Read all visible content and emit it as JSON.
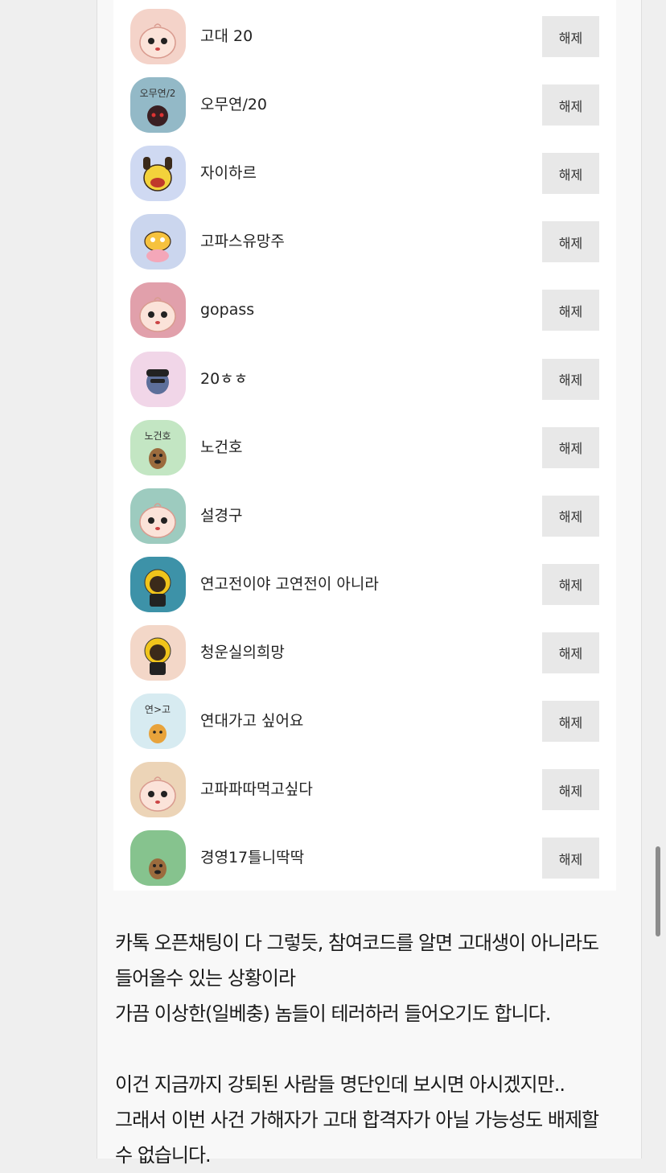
{
  "blocked_list": {
    "unblock_label": "해제",
    "items": [
      {
        "name": "고대 20",
        "bg": "#f4d3c9",
        "avatar": "apeach-icon"
      },
      {
        "name": "오무연/20",
        "bg": "#93b9c7",
        "avatar": "dark-character-icon",
        "avatar_text": "오무연/2"
      },
      {
        "name": "자이하르",
        "bg": "#cfd9f2",
        "avatar": "muzi-icon"
      },
      {
        "name": "고파스유망주",
        "bg": "#cbd6ee",
        "avatar": "frodo-icon"
      },
      {
        "name": "gopass",
        "bg": "#e1a0ab",
        "avatar": "apeach-icon"
      },
      {
        "name": "20ㅎㅎ",
        "bg": "#f1d6e8",
        "avatar": "jay-g-icon"
      },
      {
        "name": "노건호",
        "bg": "#c3e6c3",
        "avatar": "dog-icon",
        "avatar_text": "노건호"
      },
      {
        "name": "설경구",
        "bg": "#9dcbbf",
        "avatar": "apeach-icon"
      },
      {
        "name": "연고전이야 고연전이 아니라",
        "bg": "#3d92a8",
        "avatar": "con-icon"
      },
      {
        "name": "청운실의희망",
        "bg": "#f3d7c8",
        "avatar": "con-icon"
      },
      {
        "name": "연대가고 싶어요",
        "bg": "#d7ebf1",
        "avatar": "ryan-icon",
        "avatar_text": "연>고"
      },
      {
        "name": "고파파따먹고싶다",
        "bg": "#ecd4b7",
        "avatar": "apeach-icon"
      },
      {
        "name": "경영17틀니딱딱",
        "bg": "#86c38e",
        "avatar": "dog-icon"
      }
    ]
  },
  "body_text": {
    "p1": [
      "카톡 오픈채팅이 다 그렇듯, 참여코드를 알면 고대생이 아니라도",
      "들어올수 있는 상황이라",
      "가끔 이상한(일베충) 놈들이 테러하러 들어오기도 합니다."
    ],
    "p2": [
      "이건 지금까지 강퇴된 사람들 명단인데 보시면 아시겠지만..",
      "그래서 이번 사건 가해자가 고대 합격자가 아닐 가능성도 배제할",
      "수 없습니다."
    ]
  }
}
